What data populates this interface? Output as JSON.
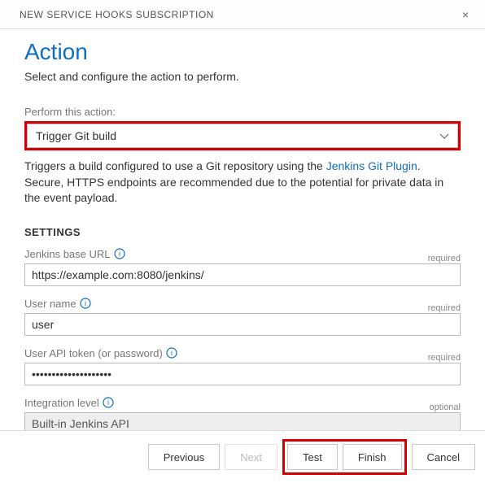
{
  "dialog": {
    "title": "NEW SERVICE HOOKS SUBSCRIPTION",
    "close_glyph": "×"
  },
  "page": {
    "heading": "Action",
    "subheading": "Select and configure the action to perform."
  },
  "action_select": {
    "label": "Perform this action:",
    "value": "Trigger Git build"
  },
  "description": {
    "part1": "Triggers a build configured to use a Git repository using the ",
    "link_text": "Jenkins Git Plugin",
    "part2": ". Secure, HTTPS endpoints are recommended due to the potential for private data in the event payload."
  },
  "settings": {
    "heading": "SETTINGS",
    "jenkins_url": {
      "label": "Jenkins base URL",
      "req": "required",
      "value": "https://example.com:8080/jenkins/"
    },
    "username": {
      "label": "User name",
      "req": "required",
      "value": "user"
    },
    "token": {
      "label": "User API token (or password)",
      "req": "required",
      "value": "••••••••••••••••••••"
    },
    "integration": {
      "label": "Integration level",
      "req": "optional",
      "value": "Built-in Jenkins API"
    }
  },
  "footer": {
    "previous": "Previous",
    "next": "Next",
    "test": "Test",
    "finish": "Finish",
    "cancel": "Cancel"
  }
}
